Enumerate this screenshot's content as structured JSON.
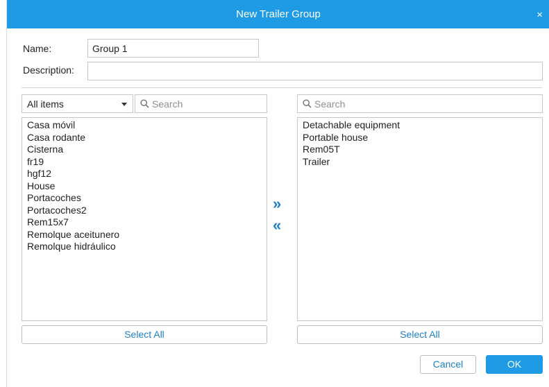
{
  "dialog": {
    "title": "New Trailer Group",
    "close_glyph": "×"
  },
  "form": {
    "name_label": "Name:",
    "name_value": "Group 1",
    "description_label": "Description:",
    "description_value": ""
  },
  "left_panel": {
    "filter_selected": "All items",
    "search_placeholder": "Search",
    "items": [
      "Casa móvil",
      "Casa rodante",
      "Cisterna",
      "fr19",
      "hgf12",
      "House",
      "Portacoches",
      "Portacoches2",
      "Rem15x7",
      "Remolque aceitunero",
      "Remolque hidráulico"
    ],
    "select_all_label": "Select All"
  },
  "right_panel": {
    "search_placeholder": "Search",
    "items": [
      "Detachable equipment",
      "Portable house",
      "Rem05T",
      "Trailer"
    ],
    "select_all_label": "Select All"
  },
  "movers": {
    "add_glyph": "»",
    "remove_glyph": "«"
  },
  "footer": {
    "cancel_label": "Cancel",
    "ok_label": "OK"
  },
  "colors": {
    "accent": "#1e9be4",
    "link_text": "#1e7fc4",
    "border": "#c7c7c7"
  }
}
